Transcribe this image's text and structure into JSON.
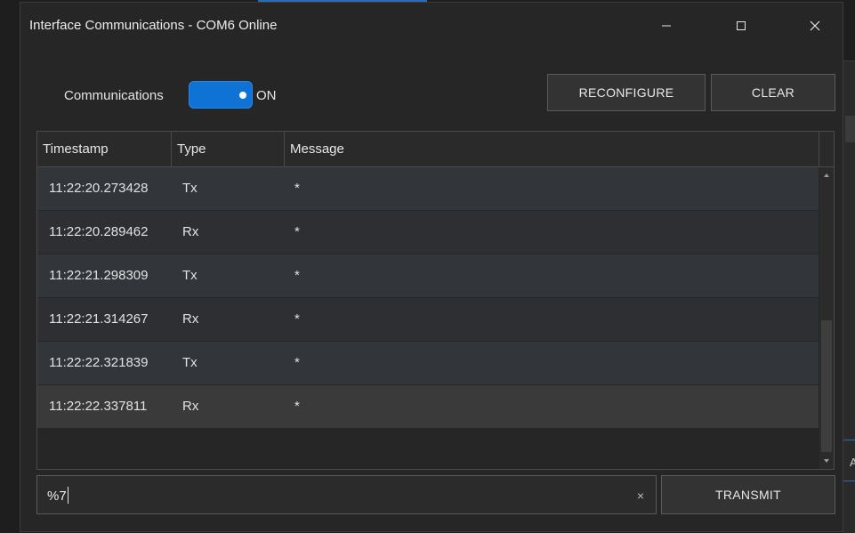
{
  "window": {
    "title": "Interface Communications - COM6 Online"
  },
  "controls": {
    "communications_label": "Communications",
    "toggle_state": "ON",
    "toggle_on": true,
    "reconfigure_label": "RECONFIGURE",
    "clear_label": "CLEAR",
    "transmit_label": "TRANSMIT"
  },
  "table": {
    "columns": [
      "Timestamp",
      "Type",
      "Message"
    ],
    "rows": [
      {
        "timestamp": "11:22:20.273428",
        "type": "Tx",
        "message": "*"
      },
      {
        "timestamp": "11:22:20.289462",
        "type": "Rx",
        "message": "*"
      },
      {
        "timestamp": "11:22:21.298309",
        "type": "Tx",
        "message": "*"
      },
      {
        "timestamp": "11:22:21.314267",
        "type": "Rx",
        "message": "*"
      },
      {
        "timestamp": "11:22:22.321839",
        "type": "Tx",
        "message": "*"
      },
      {
        "timestamp": "11:22:22.337811",
        "type": "Rx",
        "message": "*"
      }
    ],
    "selected_row": 5
  },
  "input": {
    "value": "%7",
    "clear_glyph": "×"
  },
  "icons": {
    "minimize": "minimize-icon",
    "maximize": "maximize-icon",
    "close": "close-icon",
    "scroll_up": "chevron-up-icon",
    "scroll_down": "chevron-down-icon",
    "clear_input": "clear-input-icon"
  },
  "colors": {
    "accent": "#0f73d6",
    "background": "#262626",
    "row_alt": "#323539",
    "row_selected": "#3a3a3a"
  },
  "background_app": {
    "edge_char": "A"
  }
}
